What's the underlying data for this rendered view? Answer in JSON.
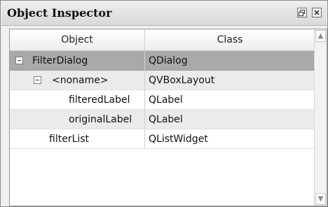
{
  "panel": {
    "title": "Object Inspector",
    "buttons": [
      "float-icon",
      "close-icon"
    ]
  },
  "tree": {
    "columns": [
      "Object",
      "Class"
    ],
    "rows": [
      {
        "object": "FilterDialog",
        "class": "QDialog",
        "expander": "minus",
        "state": "selected"
      },
      {
        "object": "<noname>",
        "class": "QVBoxLayout",
        "expander": "minus",
        "state": "alternate"
      },
      {
        "object": "filteredLabel",
        "class": "QLabel",
        "expander": "",
        "state": "normal"
      },
      {
        "object": "originalLabel",
        "class": "QLabel",
        "expander": "",
        "state": "alternate"
      },
      {
        "object": "filterList",
        "class": "QListWidget",
        "expander": "",
        "state": "normal"
      }
    ]
  },
  "scrollbar": {
    "up_icon": "arrow-up-icon",
    "down_icon": "arrow-down-icon"
  }
}
